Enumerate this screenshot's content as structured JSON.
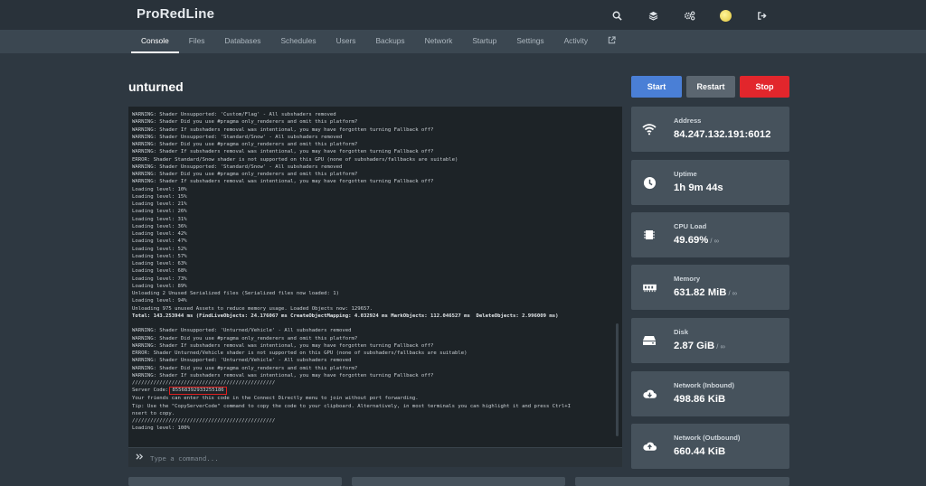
{
  "app": {
    "brand": "ProRedLine"
  },
  "top_icons": [
    "search-icon",
    "layers-icon",
    "settings-icon",
    "avatar",
    "logout-icon"
  ],
  "nav": {
    "tabs": [
      {
        "label": "Console",
        "active": true
      },
      {
        "label": "Files"
      },
      {
        "label": "Databases"
      },
      {
        "label": "Schedules"
      },
      {
        "label": "Users"
      },
      {
        "label": "Backups"
      },
      {
        "label": "Network"
      },
      {
        "label": "Startup"
      },
      {
        "label": "Settings"
      },
      {
        "label": "Activity"
      }
    ]
  },
  "server": {
    "name": "unturned"
  },
  "power": {
    "start": "Start",
    "restart": "Restart",
    "stop": "Stop"
  },
  "console": {
    "lines": [
      "WARNING: Shader Unsupported: 'Custom/Flag' - All subshaders removed",
      "WARNING: Shader Did you use #pragma only_renderers and omit this platform?",
      "WARNING: Shader If subshaders removal was intentional, you may have forgotten turning Fallback off?",
      "WARNING: Shader Unsupported: 'Standard/Snow' - All subshaders removed",
      "WARNING: Shader Did you use #pragma only_renderers and omit this platform?",
      "WARNING: Shader If subshaders removal was intentional, you may have forgotten turning Fallback off?",
      "ERROR: Shader Standard/Snow shader is not supported on this GPU (none of subshaders/fallbacks are suitable)",
      "WARNING: Shader Unsupported: 'Standard/Snow' - All subshaders removed",
      "WARNING: Shader Did you use #pragma only_renderers and omit this platform?",
      "WARNING: Shader If subshaders removal was intentional, you may have forgotten turning Fallback off?",
      "Loading level: 10%",
      "Loading level: 15%",
      "Loading level: 21%",
      "Loading level: 26%",
      "Loading level: 31%",
      "Loading level: 36%",
      "Loading level: 42%",
      "Loading level: 47%",
      "Loading level: 52%",
      "Loading level: 57%",
      "Loading level: 63%",
      "Loading level: 68%",
      "Loading level: 73%",
      "Loading level: 89%",
      "Unloading 2 Unused Serialized files (Serialized files now loaded: 1)",
      "Loading level: 94%",
      "Unloading 975 unused Assets to reduce memory usage. Loaded Objects now: 129657.",
      "Total: 143.253944 ms (FindLiveObjects: 24.176067 ms CreateObjectMapping: 4.032924 ms MarkObjects: 112.046527 ms  DeleteObjects: 2.996009 ms)",
      "",
      "WARNING: Shader Unsupported: 'Unturned/Vehicle' - All subshaders removed",
      "WARNING: Shader Did you use #pragma only_renderers and omit this platform?",
      "WARNING: Shader If subshaders removal was intentional, you may have forgotten turning Fallback off?",
      "ERROR: Shader Unturned/Vehicle shader is not supported on this GPU (none of subshaders/fallbacks are suitable)",
      "WARNING: Shader Unsupported: 'Unturned/Vehicle' - All subshaders removed",
      "WARNING: Shader Did you use #pragma only_renderers and omit this platform?",
      "WARNING: Shader If subshaders removal was intentional, you may have forgotten turning Fallback off?",
      "///////////////////////////////////////////////"
    ],
    "server_code_label": "Server Code:",
    "server_code": "85568392933255186",
    "lines_after": [
      "Your friends can enter this code in the Connect Directly menu to join without port forwarding.",
      "Tip: Use the \"CopyServerCode\" command to copy the code to your clipboard. Alternatively, in most terminals you can highlight it and press Ctrl+I",
      "nsert to copy.",
      "///////////////////////////////////////////////",
      "Loading level: 100%"
    ],
    "command_placeholder": "Type a command..."
  },
  "stats": [
    {
      "label": "Address",
      "value": "84.247.132.191:6012",
      "limit": "",
      "icon": "wifi-icon"
    },
    {
      "label": "Uptime",
      "value": "1h 9m 44s",
      "limit": "",
      "icon": "clock-icon"
    },
    {
      "label": "CPU Load",
      "value": "49.69%",
      "limit": " / ∞",
      "icon": "cpu-icon"
    },
    {
      "label": "Memory",
      "value": "631.82 MiB",
      "limit": " / ∞",
      "icon": "memory-icon"
    },
    {
      "label": "Disk",
      "value": "2.87 GiB",
      "limit": " / ∞",
      "icon": "hdd-icon"
    },
    {
      "label": "Network (Inbound)",
      "value": "498.86 KiB",
      "limit": "",
      "icon": "cloud-download-icon"
    },
    {
      "label": "Network (Outbound)",
      "value": "660.44 KiB",
      "limit": "",
      "icon": "cloud-upload-icon"
    }
  ]
}
